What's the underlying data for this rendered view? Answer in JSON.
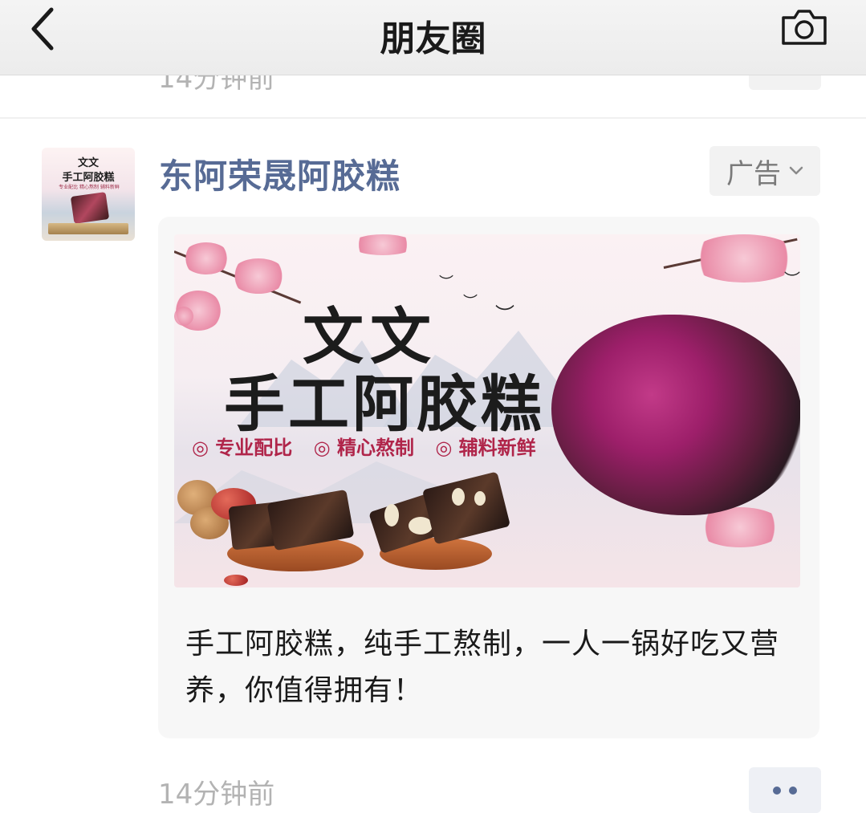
{
  "nav": {
    "title": "朋友圈"
  },
  "previous_post": {
    "time": "14分钟前"
  },
  "post": {
    "account_name": "东阿荣晟阿胶糕",
    "ad_label": "广告",
    "avatar": {
      "title_line1": "文文",
      "title_line2": "手工阿胶糕",
      "tags": "专业配比 精心熬制 辅料新鲜"
    },
    "banner": {
      "title_line1": "文文",
      "title_line2": "手工阿胶糕",
      "tags": [
        "◎ 专业配比",
        "◎ 精心熬制",
        "◎ 辅料新鲜"
      ]
    },
    "description": "手工阿胶糕，纯手工熬制，一人一锅好吃又营养，你值得拥有！",
    "time": "14分钟前"
  },
  "icons": [
    "chevron-left-icon",
    "camera-icon",
    "chevron-down-icon",
    "more-dots-icon"
  ],
  "colors": {
    "account_name": "#576b95",
    "time": "#b3b3b3",
    "nav_bg": "#f1f1f1",
    "card_bg": "#f7f7f7"
  }
}
